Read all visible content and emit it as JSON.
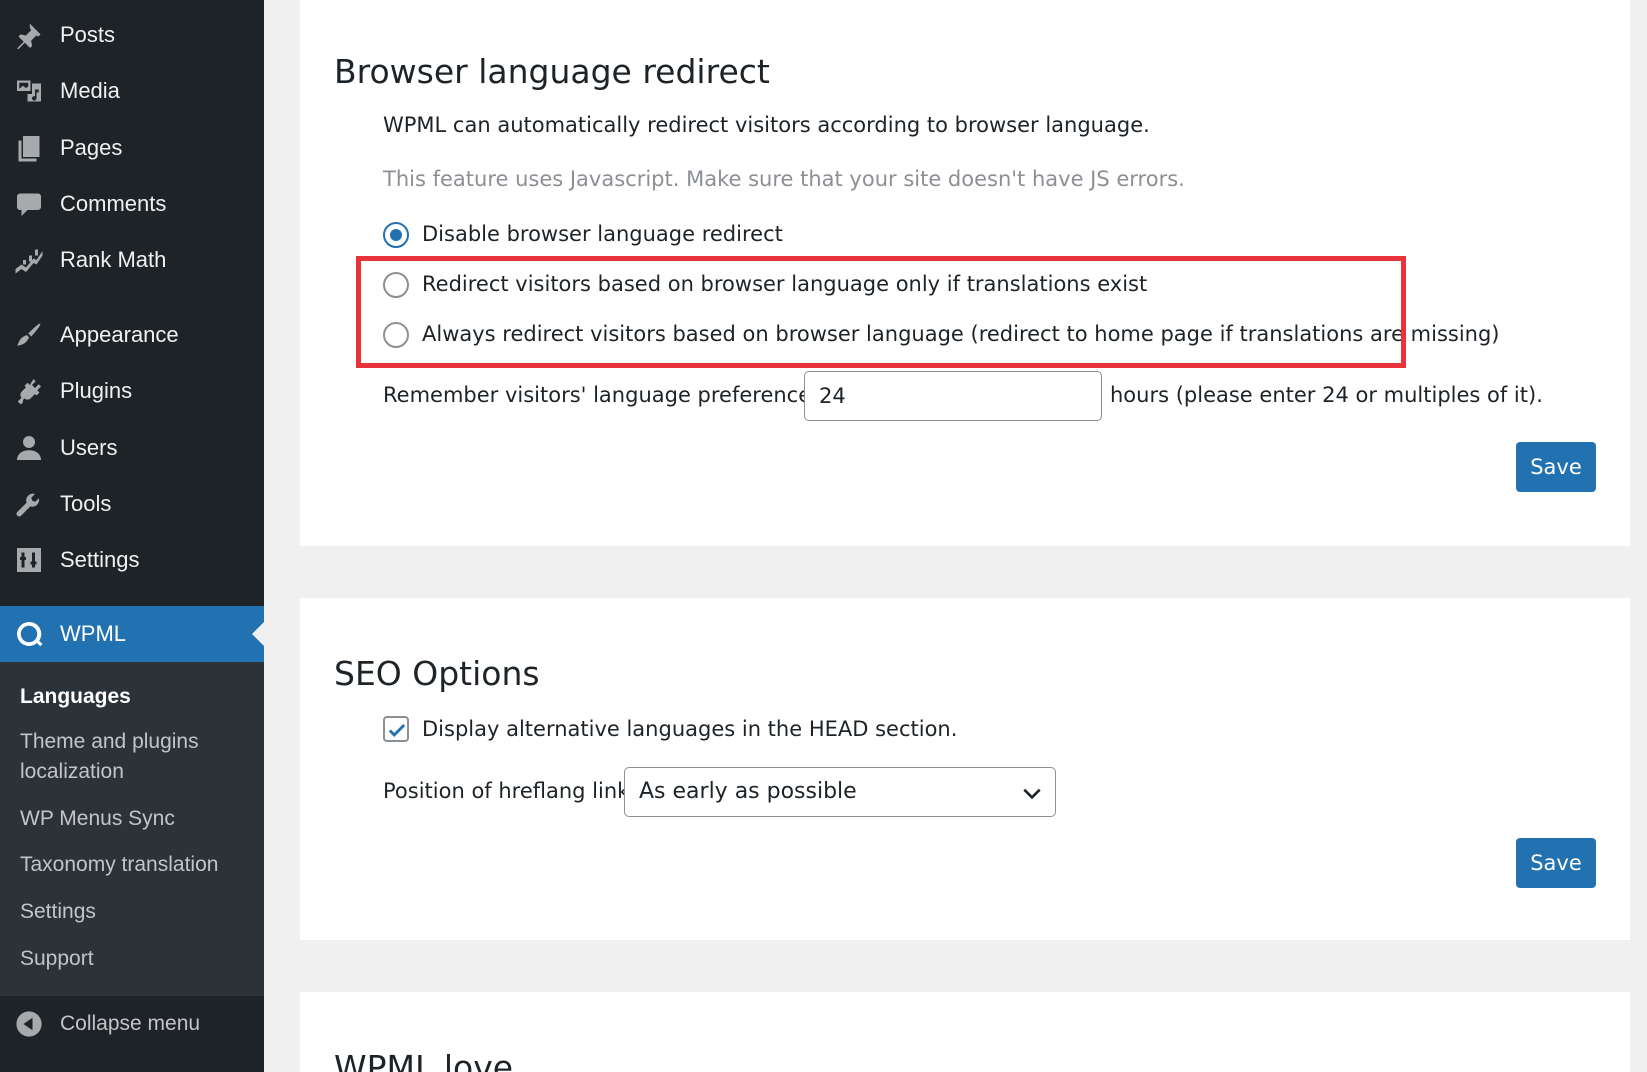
{
  "sidebar": {
    "items": [
      {
        "label": "Posts",
        "icon": "pushpin-icon"
      },
      {
        "label": "Media",
        "icon": "media-icon"
      },
      {
        "label": "Pages",
        "icon": "pages-icon"
      },
      {
        "label": "Comments",
        "icon": "comment-icon"
      },
      {
        "label": "Rank Math",
        "icon": "rank-math-icon"
      },
      {
        "label": "Appearance",
        "icon": "paintbrush-icon"
      },
      {
        "label": "Plugins",
        "icon": "plugin-icon"
      },
      {
        "label": "Users",
        "icon": "user-icon"
      },
      {
        "label": "Tools",
        "icon": "wrench-icon"
      },
      {
        "label": "Settings",
        "icon": "settings-icon"
      }
    ],
    "active": {
      "label": "WPML",
      "icon": "wpml-icon"
    },
    "submenu": [
      {
        "label": "Languages",
        "current": true
      },
      {
        "label": "Theme and plugins localization",
        "current": false
      },
      {
        "label": "WP Menus Sync",
        "current": false
      },
      {
        "label": "Taxonomy translation",
        "current": false
      },
      {
        "label": "Settings",
        "current": false
      },
      {
        "label": "Support",
        "current": false
      }
    ],
    "collapse_label": "Collapse menu",
    "colors": {
      "background": "#1d2327",
      "submenu_background": "#2c3338",
      "active": "#2271b1"
    }
  },
  "redirect_panel": {
    "title": "Browser language redirect",
    "description": "WPML can automatically redirect visitors according to browser language.",
    "note": "This feature uses Javascript. Make sure that your site doesn't have JS errors.",
    "options": [
      {
        "label": "Disable browser language redirect",
        "checked": true
      },
      {
        "label": "Redirect visitors based on browser language only if translations exist",
        "checked": false
      },
      {
        "label": "Always redirect visitors based on browser language (redirect to home page if translations are missing)",
        "checked": false
      }
    ],
    "remember_label": "Remember visitors' language preference for",
    "remember_value": "24",
    "remember_suffix": "hours (please enter 24 or multiples of it).",
    "save_label": "Save",
    "highlight_color": "#e8333a"
  },
  "seo_panel": {
    "title": "SEO Options",
    "checkbox_label": "Display alternative languages in the HEAD section.",
    "checkbox_checked": true,
    "hreflang_label": "Position of hreflang links",
    "hreflang_value": "As early as possible",
    "save_label": "Save"
  },
  "love_panel": {
    "title": "WPML love"
  },
  "accent_color": "#2271b1"
}
